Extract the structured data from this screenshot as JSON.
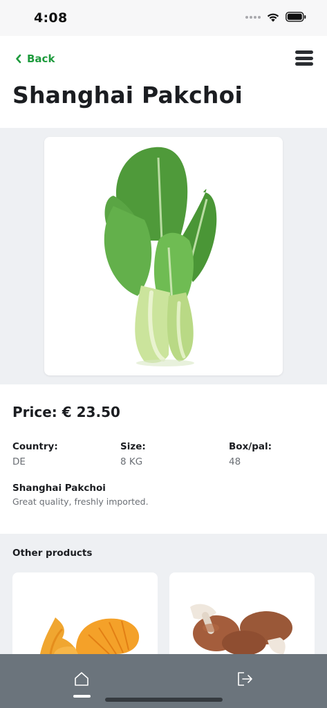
{
  "status_bar": {
    "time": "4:08"
  },
  "header": {
    "back_label": "Back",
    "title": "Shanghai Pakchoi"
  },
  "product": {
    "image_icon": "pakchoi-image",
    "price_text": "Price: € 23.50",
    "specs": [
      {
        "label": "Country:",
        "value": "DE"
      },
      {
        "label": "Size:",
        "value": "8 KG"
      },
      {
        "label": "Box/pal:",
        "value": "48"
      }
    ],
    "name": "Shanghai Pakchoi",
    "description": "Great quality, freshly imported."
  },
  "other_products": {
    "title": "Other products",
    "items": [
      {
        "image_icon": "chanterelle-mushroom-image"
      },
      {
        "image_icon": "brown-mushroom-image"
      }
    ]
  },
  "tab_bar": {
    "tabs": [
      {
        "icon": "home-icon",
        "active": true
      },
      {
        "icon": "logout-icon",
        "active": false
      }
    ]
  },
  "colors": {
    "accent": "#1e9b3d",
    "tab_bar": "#6b747c",
    "section_bg": "#eef0f3"
  }
}
